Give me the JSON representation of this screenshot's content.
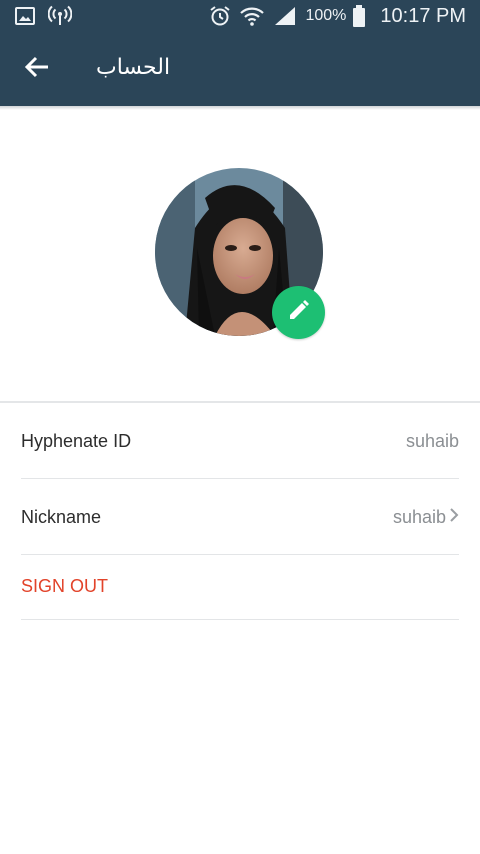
{
  "status_bar": {
    "battery_percent": "100%",
    "time": "10:17 PM",
    "icons": [
      "gallery-icon",
      "hotspot-icon",
      "alarm-icon",
      "wifi-icon",
      "signal-icon",
      "battery-icon"
    ]
  },
  "toolbar": {
    "title": "الحساب",
    "back_icon": "arrow-back-icon"
  },
  "profile": {
    "avatar": "profile-photo",
    "edit_icon": "pencil-icon"
  },
  "rows": [
    {
      "label": "Hyphenate ID",
      "value": "suhaib",
      "has_chevron": false
    },
    {
      "label": "Nickname",
      "value": "suhaib",
      "has_chevron": true
    }
  ],
  "sign_out": {
    "label": "SIGN OUT"
  },
  "colors": {
    "app_bar": "#2b4558",
    "accent_green": "#1dbf73",
    "sign_out_red": "#e2432a",
    "value_gray": "#8b8f93"
  }
}
